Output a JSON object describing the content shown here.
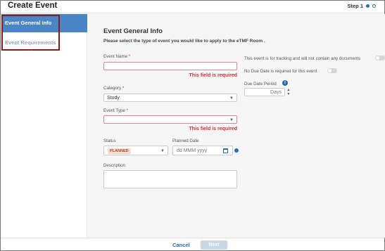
{
  "header": {
    "title": "Create Event",
    "step_label": "Step 1"
  },
  "sidebar": {
    "items": [
      {
        "label": "Event General Info"
      },
      {
        "label": "Event Requirements"
      }
    ]
  },
  "main": {
    "section_title": "Event General Info",
    "section_subtitle": "Please select the type of event you would like to apply to the eTMF Room .",
    "event_name": {
      "label": "Event Name",
      "required_mark": "*",
      "value": "",
      "error": "This field is required"
    },
    "category": {
      "label": "Category",
      "required_mark": "*",
      "value": "Study"
    },
    "event_type": {
      "label": "Event Type",
      "required_mark": "*",
      "value": "",
      "error": "This field is required"
    },
    "status": {
      "label": "Status",
      "value": "PLANNED"
    },
    "planned_date": {
      "label": "Planned Date",
      "placeholder": "dd MMM yyyy"
    },
    "description": {
      "label": "Description",
      "value": ""
    },
    "tracking_toggle": {
      "label": "This event is for tracking and will not contain any documents",
      "on": false
    },
    "no_due_date_toggle": {
      "label": "No Due Date is required for this event",
      "on": false
    },
    "due_date_period": {
      "label": "Due Date Period",
      "unit": "Days",
      "info": "i"
    }
  },
  "footer": {
    "cancel_label": "Cancel",
    "next_label": "Next"
  },
  "colors": {
    "accent": "#4a86c5",
    "link": "#2a6aad",
    "error": "#c83232",
    "highlight_border": "#8b1a1a"
  }
}
